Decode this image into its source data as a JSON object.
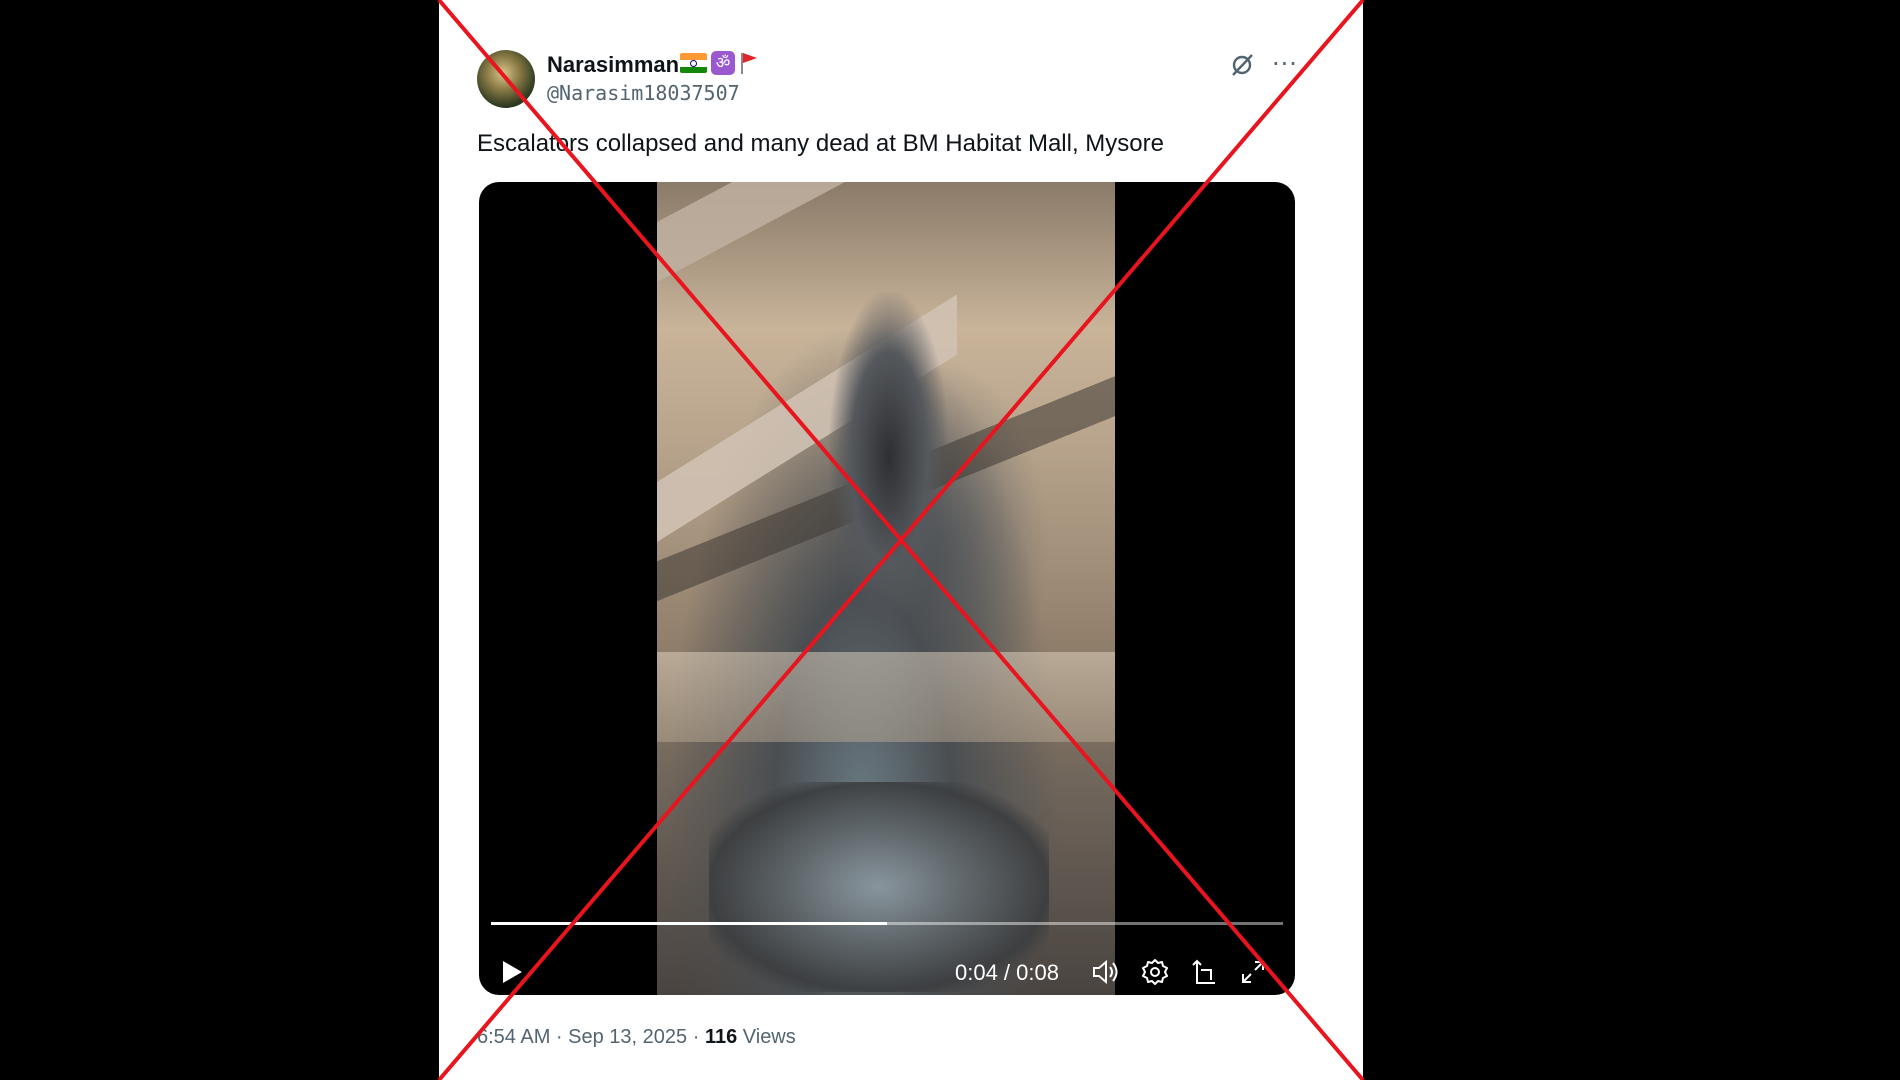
{
  "tweet": {
    "author_name": "Narasimman",
    "author_handle": "@Narasim18037507",
    "author_badges": [
      "india-flag-icon",
      "om-icon",
      "pennant-flag-icon"
    ],
    "text": "Escalators collapsed and many dead at BM Habitat Mall, Mysore",
    "timestamp": "6:54 AM · Sep 13, 2025 ·",
    "views_count": "116",
    "views_label": "Views"
  },
  "video": {
    "time_display": "0:04 / 0:08",
    "progress_fraction": 0.5,
    "controls": [
      "play-icon",
      "volume-icon",
      "settings-icon",
      "picture-in-picture-icon",
      "fullscreen-icon"
    ]
  },
  "icons": {
    "grok": "grok-icon",
    "more": "more-options-icon"
  },
  "colors": {
    "text_primary": "#0f1419",
    "text_secondary": "#536471",
    "cross_mark": "#e8141e",
    "background": "#000000",
    "card": "#ffffff"
  }
}
